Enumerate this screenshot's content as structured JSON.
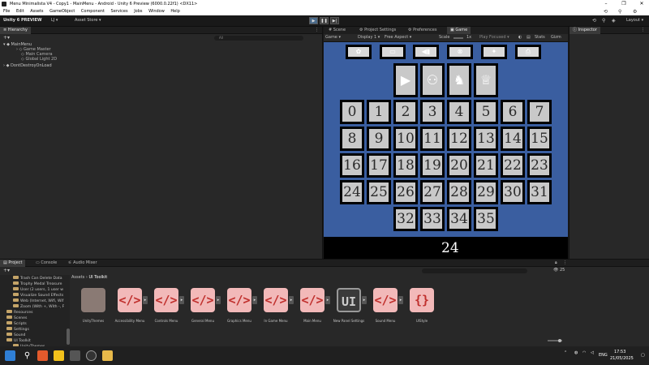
{
  "titlebar": {
    "title": "Menu Minimalista V4 - Copy1 - MainMenu - Android - Unity 6 Preview (6000.0.22f1) <DX11>",
    "minimize": "–",
    "maximize": "❐",
    "close": "✕"
  },
  "menubar": {
    "items": [
      "File",
      "Edit",
      "Assets",
      "GameObject",
      "Component",
      "Services",
      "Jobs",
      "Window",
      "Help"
    ]
  },
  "toolbar": {
    "brand": "Unity 6 PREVIEW",
    "account": "LJ ▾",
    "asset_store": "Asset Store ▾",
    "play": "▶",
    "pause": "❚❚",
    "step": "▶|",
    "layout": "Layout ▾"
  },
  "hierarchy": {
    "tab": "Hierarchy",
    "search_placeholder": "All",
    "scene": "MainMenu",
    "children": [
      "Game Master",
      "Main Camera",
      "Global Light 2D"
    ],
    "ddol": "DontDestroyOnLoad"
  },
  "center_tabs": {
    "scene": "Scene",
    "project_settings": "Project Settings",
    "preferences": "Preferences",
    "game": "Game"
  },
  "game_toolbar": {
    "mode": "Game ▾",
    "display": "Display 1 ▾",
    "aspect": "Free Aspect ▾",
    "scale_label": "Scale",
    "scale_value": "1x",
    "play_focused": "Play Focused ▾",
    "stats": "Stats",
    "gizmos": "Gizm"
  },
  "game_view": {
    "bg_color": "#3a5ea0",
    "top_icons": [
      "✿",
      "▭",
      "◀▮",
      "⊗",
      "✦",
      "⎙"
    ],
    "menu_icons": [
      "▶",
      "⚇",
      "♞",
      "♕"
    ],
    "numbers": [
      "0",
      "1",
      "2",
      "3",
      "4",
      "5",
      "6",
      "7",
      "8",
      "9",
      "10",
      "11",
      "12",
      "13",
      "14",
      "15",
      "16",
      "17",
      "18",
      "19",
      "20",
      "21",
      "22",
      "23",
      "24",
      "25",
      "26",
      "27",
      "28",
      "29",
      "30",
      "31",
      "32",
      "33",
      "34",
      "35"
    ],
    "selected": "24"
  },
  "inspector": {
    "tab": "Inspector"
  },
  "bottom_tabs": {
    "project": "Project",
    "console": "Console",
    "audio_mixer": "Audio Mixer",
    "count": "25"
  },
  "project_tree": [
    {
      "label": "Trash Can Delete Data",
      "level": 2
    },
    {
      "label": "Trophy Medal Treasure",
      "level": 2
    },
    {
      "label": "User (2 users, 1 user w",
      "level": 2
    },
    {
      "label": "Visualize Sound Effects",
      "level": 2
    },
    {
      "label": "Web (Internet, Wifi, Wif",
      "level": 2
    },
    {
      "label": "Zoom (With +, With -, F",
      "level": 2
    },
    {
      "label": "Resources",
      "level": 0
    },
    {
      "label": "Scenes",
      "level": 0
    },
    {
      "label": "Scripts",
      "level": 0
    },
    {
      "label": "Settings",
      "level": 0
    },
    {
      "label": "Sound",
      "level": 0
    },
    {
      "label": "UI Toolkit",
      "level": 0
    },
    {
      "label": "UnityThemes",
      "level": 2
    }
  ],
  "breadcrumb": {
    "root": "Assets",
    "sep": "›",
    "current": "UI Toolkit"
  },
  "assets": [
    {
      "label": "UnityThemes",
      "kind": "folder"
    },
    {
      "label": "Accessibility Menu",
      "kind": "uxml"
    },
    {
      "label": "Controls Menu",
      "kind": "uxml"
    },
    {
      "label": "General Menu",
      "kind": "uxml"
    },
    {
      "label": "Graphics Menu",
      "kind": "uxml"
    },
    {
      "label": "In Game Menu",
      "kind": "uxml"
    },
    {
      "label": "Main Menu",
      "kind": "uxml"
    },
    {
      "label": "New Panel Settings",
      "kind": "panel"
    },
    {
      "label": "Sound Menu",
      "kind": "uxml"
    },
    {
      "label": "UIStyle",
      "kind": "uss"
    }
  ],
  "taskbar": {
    "lang": "ENG",
    "time": "17:53",
    "date": "21/05/2025"
  }
}
